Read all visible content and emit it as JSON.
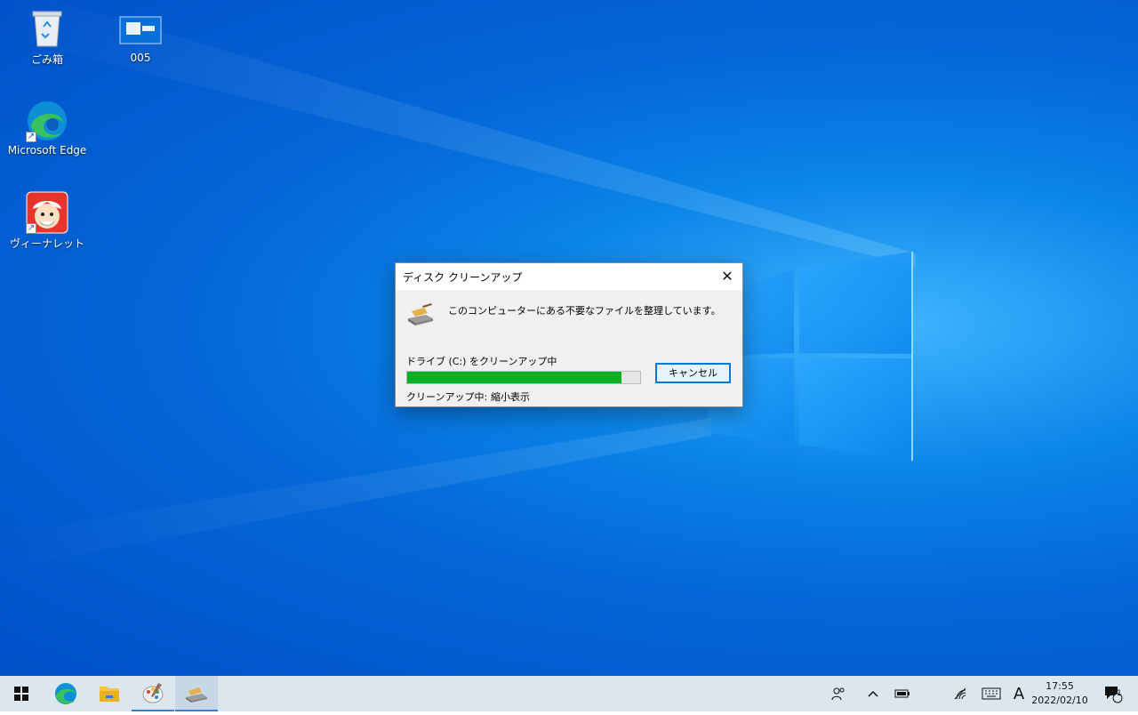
{
  "desktop": {
    "icons": [
      {
        "label": "ごみ箱",
        "icon": "recycle-bin-icon"
      },
      {
        "label": "005",
        "icon": "window-thumbnail-icon"
      },
      {
        "label": "Microsoft Edge",
        "icon": "edge-icon"
      },
      {
        "label": "ヴィーナレット",
        "icon": "app-character-icon"
      }
    ]
  },
  "dialog": {
    "title": "ディスク クリーンアップ",
    "message": "このコンピューターにある不要なファイルを整理しています。",
    "drive_label": "ドライブ  (C:) をクリーンアップ中",
    "progress": 0.92,
    "cancel_label": "キャンセル",
    "status_label": "クリーンアップ中:",
    "status_value": "縮小表示",
    "close_icon": "close-icon"
  },
  "taskbar": {
    "buttons": [
      {
        "name": "start-button",
        "icon": "windows-logo-icon"
      },
      {
        "name": "taskbar-edge",
        "icon": "edge-icon"
      },
      {
        "name": "taskbar-file-explorer",
        "icon": "folder-icon"
      },
      {
        "name": "taskbar-paint",
        "icon": "paint-palette-icon"
      },
      {
        "name": "taskbar-disk-cleanup",
        "icon": "disk-cleanup-icon",
        "active": true
      }
    ],
    "tray": {
      "people_icon": "people-icon",
      "chevron_icon": "chevron-up-icon",
      "battery_icon": "battery-icon",
      "network_icon": "wifi-icon",
      "keyboard_icon": "keyboard-icon",
      "ime_label": "A",
      "time": "17:55",
      "date": "2022/02/10",
      "notification_count": "1"
    }
  },
  "colors": {
    "progress_fill": "#06b025",
    "accent": "#0078d7",
    "taskbar_bg": "#dbe6ef"
  }
}
